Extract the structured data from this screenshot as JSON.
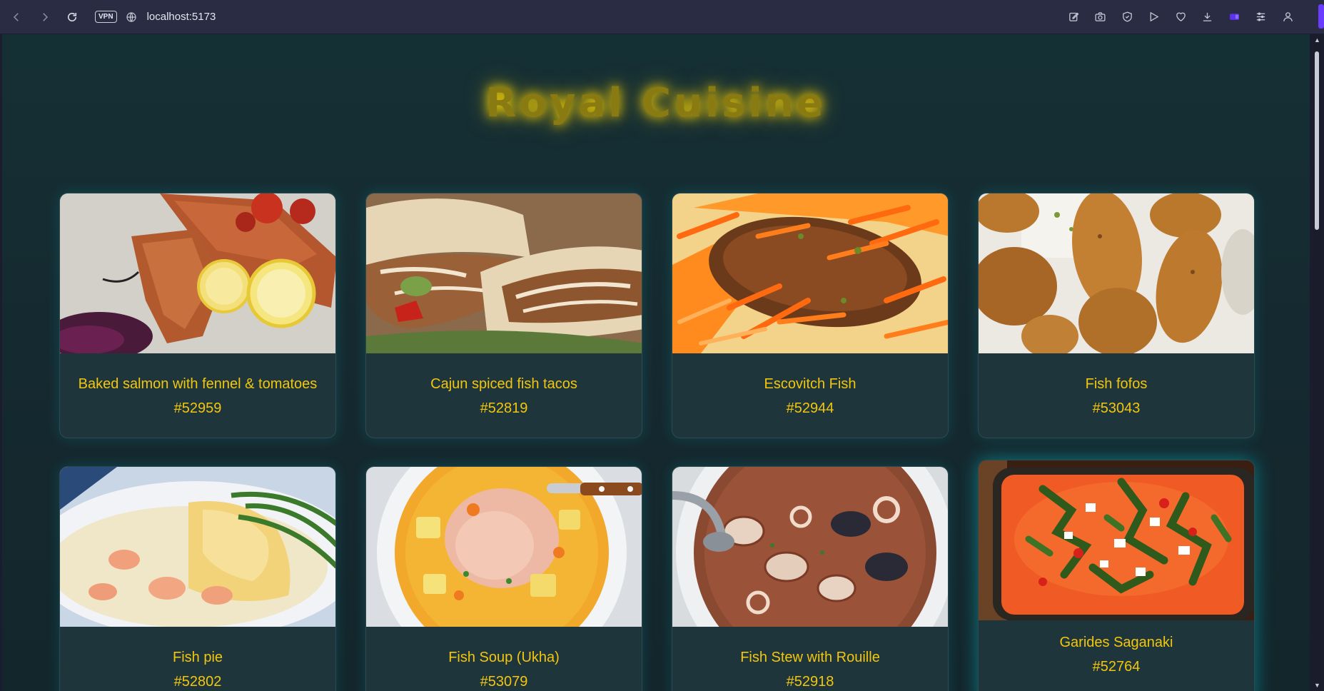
{
  "browser": {
    "url": "localhost:5173",
    "vpn_label": "VPN",
    "icons": [
      "back-icon",
      "forward-icon",
      "reload-icon",
      "globe-icon",
      "edit-icon",
      "camera-icon",
      "shield-icon",
      "play-icon",
      "heart-icon",
      "download-icon",
      "wallet-icon",
      "menu-icon",
      "profile-icon"
    ]
  },
  "page": {
    "title": "Royal Cuisine",
    "title_color": "#ffd700",
    "text_color": "#f3c60e",
    "background": "#152a30"
  },
  "meals": [
    {
      "name": "Baked salmon with fennel & tomatoes",
      "id": "#52959"
    },
    {
      "name": "Cajun spiced fish tacos",
      "id": "#52819"
    },
    {
      "name": "Escovitch Fish",
      "id": "#52944"
    },
    {
      "name": "Fish fofos",
      "id": "#53043"
    },
    {
      "name": "Fish pie",
      "id": "#52802"
    },
    {
      "name": "Fish Soup (Ukha)",
      "id": "#53079"
    },
    {
      "name": "Fish Stew with Rouille",
      "id": "#52918"
    },
    {
      "name": "Garides Saganaki",
      "id": "#52764"
    }
  ]
}
